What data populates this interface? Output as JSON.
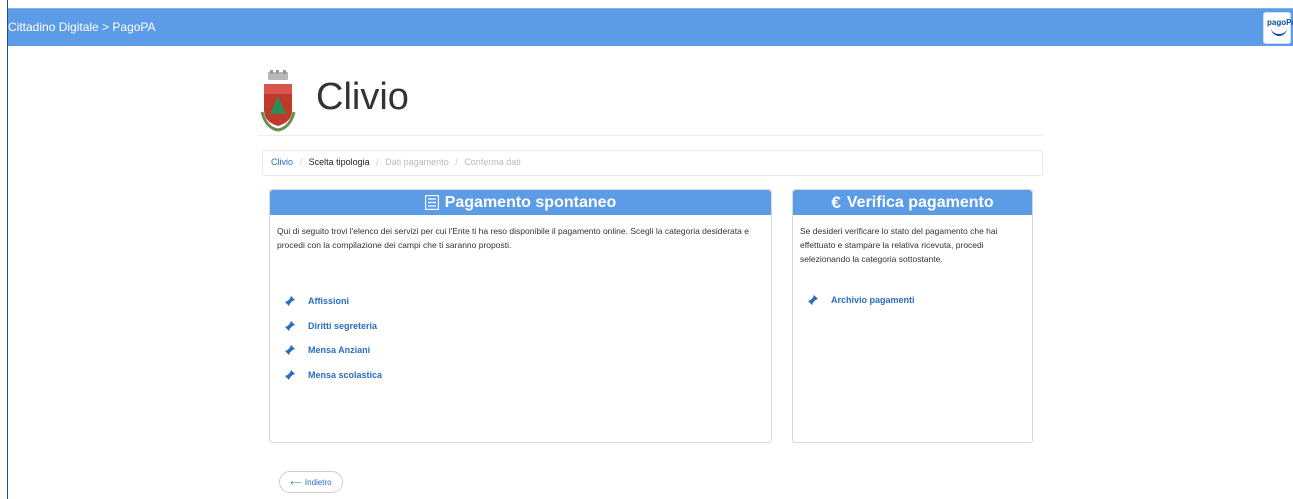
{
  "topbar": {
    "title": "Cittadino Digitale > PagoPA",
    "logo_text": "pagoPA",
    "color": "#5c9be6"
  },
  "header": {
    "title": "Clivio",
    "crest_icon": "municipal-crest-icon"
  },
  "breadcrumb": {
    "items": [
      "Clivio",
      "Scelta tipologia",
      "Dati pagamento",
      "Conferma dati"
    ],
    "separator": "/"
  },
  "left_panel": {
    "title": "Pagamento spontaneo",
    "icon": "list-document-icon",
    "description": "Qui di seguito trovi l'elenco dei servizi per cui l'Ente ti ha reso disponibile il pagamento online. Scegli la categoria desiderata e procedi con la compilazione dei campi che ti saranno proposti.",
    "links": [
      "Affissioni",
      "Diritti segreteria",
      "Mensa Anziani",
      "Mensa scolastica"
    ]
  },
  "right_panel": {
    "title": "Verifica pagamento",
    "icon": "euro-icon",
    "icon_glyph": "€",
    "description": "Se desideri verificare lo stato del pagamento che hai effettuato e stampare la relativa ricevuta, procedi selezionando la categoria sottostante.",
    "links": [
      "Archivio pagamenti"
    ]
  },
  "footer": {
    "back_label": "Indietro",
    "back_icon": "arrow-left-icon"
  }
}
